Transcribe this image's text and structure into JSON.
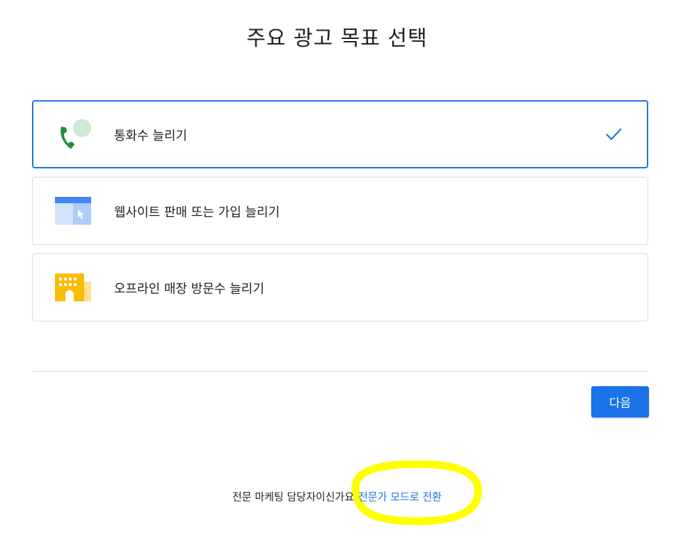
{
  "page": {
    "title": "주요 광고 목표 선택"
  },
  "options": [
    {
      "label": "통화수 늘리기",
      "icon": "phone-call-icon",
      "selected": true
    },
    {
      "label": "웹사이트 판매 또는 가입 늘리기",
      "icon": "website-browser-icon",
      "selected": false
    },
    {
      "label": "오프라인 매장 방문수 늘리기",
      "icon": "store-building-icon",
      "selected": false
    }
  ],
  "actions": {
    "next_label": "다음"
  },
  "footer": {
    "prompt": "전문 마케팅 담당자이신가요",
    "link": "전문가 모드로 전환"
  },
  "colors": {
    "accent": "#1a73e8",
    "highlight": "#ffff00",
    "phone_green": "#1e8e3e",
    "store_yellow": "#fbbc04"
  }
}
